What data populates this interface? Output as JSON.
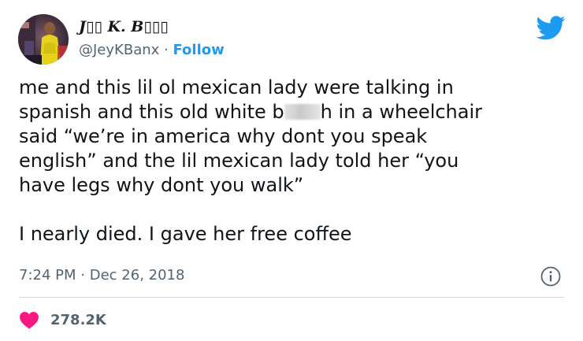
{
  "author": {
    "display_name": "J▯▯ K. B▯▯▯",
    "handle": "@JeyKBanx",
    "separator": "·",
    "follow_label": "Follow"
  },
  "tweet": {
    "lines_p1": [
      "me and this lil ol mexican lady were talking in",
      "spanish and this old white b",
      "h in a wheelchair",
      "said “we’re in america why dont you speak",
      "english” and the lil mexican lady told her “you",
      "have legs why dont you walk”"
    ],
    "p2": "I nearly died. I gave her free coffee"
  },
  "meta": {
    "time": "7:24 PM",
    "separator": "·",
    "date": "Dec 26, 2018"
  },
  "stats": {
    "likes": "278.2K"
  },
  "icons": {
    "brand": "twitter-bird-icon",
    "info": "info-icon",
    "like": "heart-icon"
  },
  "colors": {
    "brand_blue": "#1d9bf0",
    "like_red": "#f91880",
    "muted": "#536471",
    "divider": "#cfd9de"
  }
}
